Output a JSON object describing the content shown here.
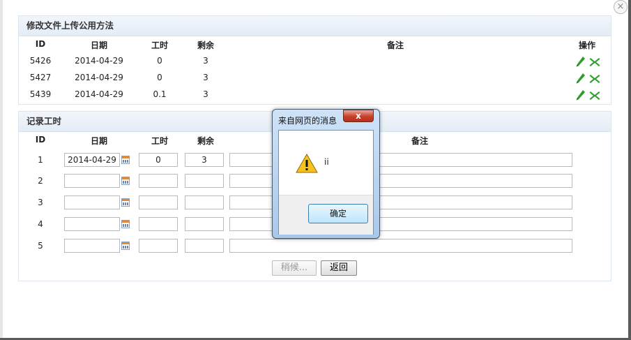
{
  "close_symbol": "×",
  "top_panel": {
    "title": "修改文件上传公用方法",
    "headers": {
      "id": "ID",
      "date": "日期",
      "hours": "工时",
      "remaining": "剩余",
      "note": "备注",
      "actions": "操作"
    },
    "rows": [
      {
        "id": "5426",
        "date": "2014-04-29",
        "hours": "0",
        "remaining": "3",
        "note": ""
      },
      {
        "id": "5427",
        "date": "2014-04-29",
        "hours": "0",
        "remaining": "3",
        "note": ""
      },
      {
        "id": "5439",
        "date": "2014-04-29",
        "hours": "0.1",
        "remaining": "3",
        "note": ""
      }
    ],
    "icons": {
      "edit": "pencil-icon",
      "delete": "delete-x-icon"
    },
    "colors": {
      "icon_green": "#2e9b2e"
    }
  },
  "record_panel": {
    "title": "记录工时",
    "headers": {
      "id": "ID",
      "date": "日期",
      "hours": "工时",
      "remaining": "剩余",
      "note": "备注"
    },
    "rows": [
      {
        "id": "1",
        "date": "2014-04-29",
        "hours": "0",
        "remaining": "3",
        "note": ""
      },
      {
        "id": "2",
        "date": "",
        "hours": "",
        "remaining": "",
        "note": ""
      },
      {
        "id": "3",
        "date": "",
        "hours": "",
        "remaining": "",
        "note": ""
      },
      {
        "id": "4",
        "date": "",
        "hours": "",
        "remaining": "",
        "note": ""
      },
      {
        "id": "5",
        "date": "",
        "hours": "",
        "remaining": "",
        "note": ""
      }
    ],
    "buttons": {
      "wait": "稍候...",
      "back": "返回"
    }
  },
  "dialog": {
    "title": "来自网页的消息",
    "close_label": "x",
    "message": "ii",
    "ok_label": "确定",
    "icon": "warning-icon"
  }
}
